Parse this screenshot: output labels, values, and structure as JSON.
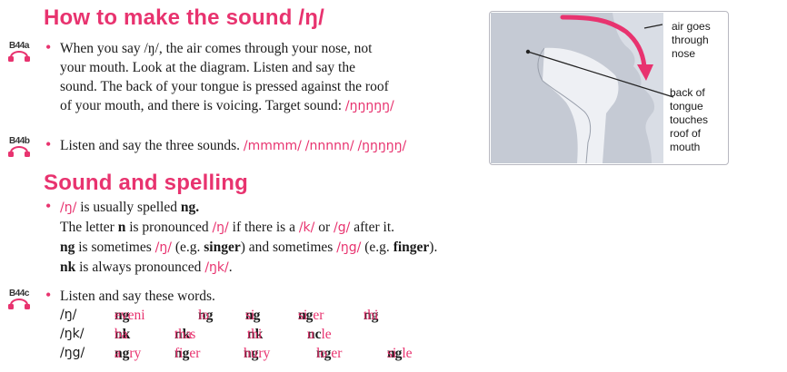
{
  "heading1": "How to make the sound /ŋ/",
  "tracks": {
    "a": "B44a",
    "b": "B44b",
    "c": "B44c"
  },
  "b1": {
    "l1": "When you say /ŋ/, the air comes through your nose, not",
    "l2": "your mouth. Look at the diagram. Listen and say the",
    "l3": "sound. The back of your tongue is pressed against the roof",
    "l4a": "of your mouth, and there is voicing. Target sound: ",
    "l4b": "/ŋŋŋŋŋ/"
  },
  "b2": {
    "text": "Listen and say the three sounds. ",
    "s1": "/mmmm/",
    "s2": "/nnnnn/",
    "s3": "/ŋŋŋŋŋ/"
  },
  "heading2": "Sound and spelling",
  "b3": {
    "l1a": "/ŋ/",
    "l1b": " is usually spelled ",
    "l1c": "ng.",
    "l2a": "The letter ",
    "l2b": "n",
    "l2c": " is pronounced ",
    "l2d": "/ŋ/",
    "l2e": " if there is a ",
    "l2f": "/k/",
    "l2g": " or ",
    "l2h": "/g/",
    "l2i": " after it.",
    "l3a": "ng",
    "l3b": " is sometimes ",
    "l3c": "/ŋ/",
    "l3d": " (e.g. ",
    "l3e": "singer",
    "l3f": ") and sometimes ",
    "l3g": "/ŋg/",
    "l3h": " (e.g. ",
    "l3i": "finger",
    "l3j": ").",
    "l4a": "nk",
    "l4b": " is always pronounced ",
    "l4c": "/ŋk/",
    "l4d": "."
  },
  "b4": {
    "text": "Listen and say these words."
  },
  "words": {
    "r1": {
      "ipa": "/ŋ/",
      "w": [
        [
          "eveni",
          "ng"
        ],
        [
          "lo",
          "ng"
        ],
        [
          "si",
          "ng"
        ],
        [
          "si",
          "ng",
          "er"
        ],
        [
          "thi",
          "ng"
        ]
      ]
    },
    "r2": {
      "ipa": "/ŋk/",
      "w": [
        [
          "ba",
          "nk"
        ],
        [
          "tha",
          "nk",
          "s"
        ],
        [
          "thi",
          "nk"
        ],
        [
          "u",
          "nc",
          "le"
        ]
      ]
    },
    "r3": {
      "ipa": "/ŋg/",
      "w": [
        [
          "a",
          "ng",
          "ry"
        ],
        [
          "fi",
          "ng",
          "er"
        ],
        [
          "hu",
          "ng",
          "ry"
        ],
        [
          "lo",
          "ng",
          "er"
        ],
        [
          "si",
          "ng",
          "le"
        ]
      ]
    }
  },
  "diagram": {
    "air": [
      "air goes",
      "through",
      "nose"
    ],
    "tongue": [
      "back of",
      "tongue",
      "touches",
      "roof of",
      "mouth"
    ]
  }
}
